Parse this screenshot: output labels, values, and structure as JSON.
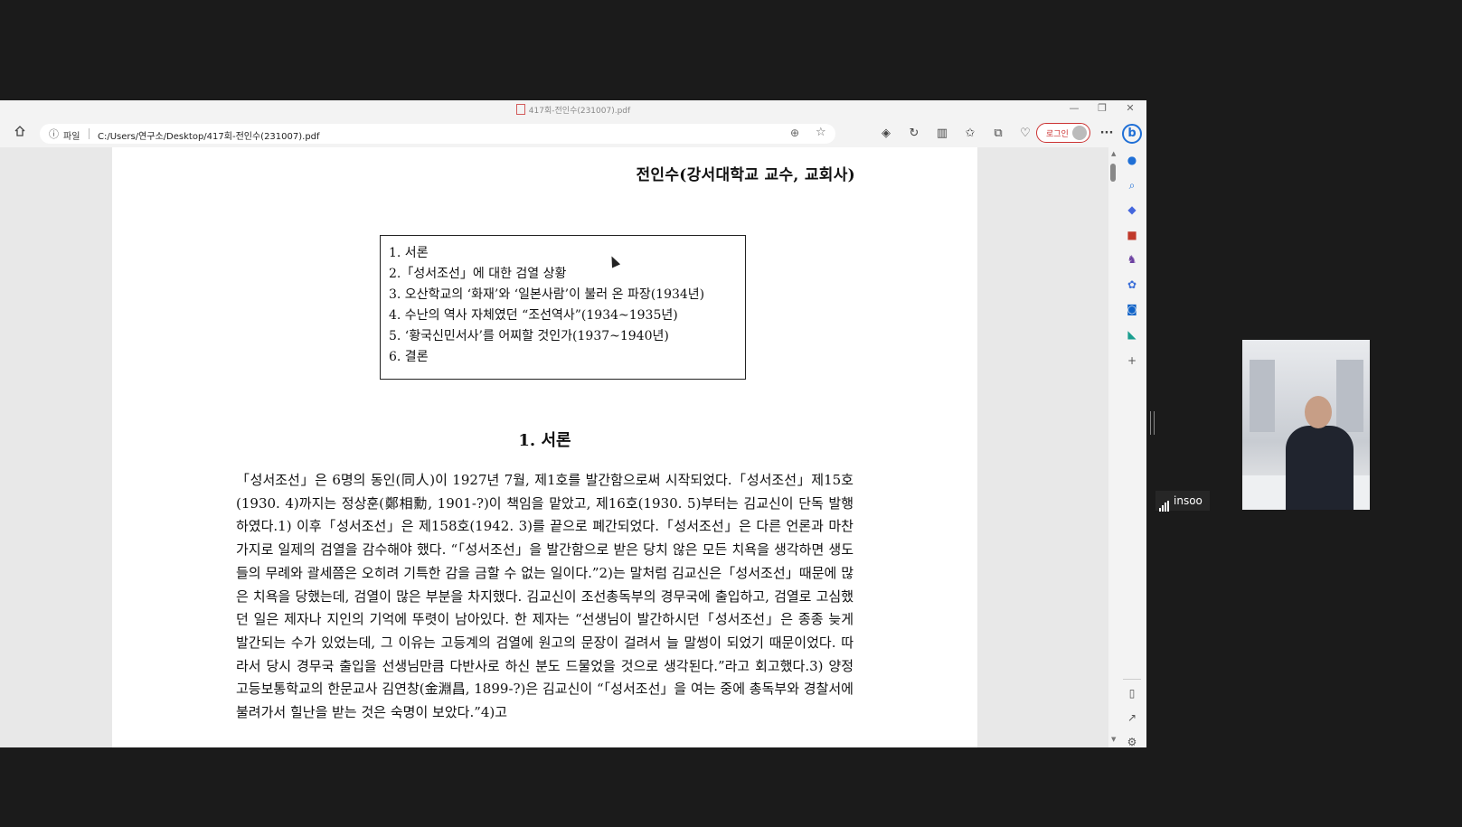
{
  "window": {
    "title": "417회-전인수(231007).pdf",
    "minimize": "—",
    "restore": "❐",
    "close": "✕"
  },
  "toolbar": {
    "home_icon": "home-icon",
    "info_icon": "info-icon",
    "address_label": "파일",
    "url": "C:/Users/연구소/Desktop/417회-전인수(231007).pdf",
    "login_label": "로그인",
    "more_label": "···",
    "bing_label": "b"
  },
  "document": {
    "author_line": "전인수(강서대학교 교수, 교회사)",
    "toc": [
      "1. 서론",
      "2.「성서조선」에 대한 검열 상황",
      "3. 오산학교의 ‘화재’와 ‘일본사람’이 불러 온 파장(1934년)",
      "4. 수난의 역사 자체였던 “조선역사”(1934~1935년)",
      "5. ‘황국신민서사’를 어찌할 것인가(1937~1940년)",
      "6. 결론"
    ],
    "section_heading": "1. 서론",
    "body": "「성서조선」은 6명의 동인(同人)이 1927년 7월, 제1호를 발간함으로써 시작되었다.「성서조선」제15호(1930. 4)까지는 정상훈(鄭相勳, 1901-?)이 책임을 맡았고, 제16호(1930. 5)부터는 김교신이 단독 발행하였다.1) 이후「성서조선」은 제158호(1942. 3)를 끝으로 폐간되었다.「성서조선」은 다른 언론과 마찬가지로 일제의 검열을 감수해야 했다. “「성서조선」을 발간함으로 받은 당치 않은 모든 치욕을 생각하면 생도들의 무례와 괄세쯤은 오히려 기특한 감을 금할 수 없는 일이다.”2)는 말처럼 김교신은「성서조선」때문에 많은 치욕을 당했는데, 검열이 많은 부분을 차지했다. 김교신이 조선총독부의 경무국에 출입하고, 검열로 고심했던 일은 제자나 지인의 기억에 뚜렷이 남아있다. 한 제자는 “선생님이 발간하시던「성서조선」은 종종 늦게 발간되는 수가 있었는데, 그 이유는 고등계의 검열에 원고의 문장이 걸려서 늘 말썽이 되었기 때문이었다. 따라서 당시 경무국 출입을 선생님만큼 다반사로 하신 분도 드물었을 것으로 생각된다.”라고 회고했다.3) 양정고등보통학교의 한문교사 김연창(金淵昌, 1899-?)은 김교신이 “「성서조선」을 여는 중에 총독부와 경찰서에 불려가서 힐난을 받는 것은 숙명이 보았다.”4)고"
  },
  "sidebar": {
    "icons": [
      "bell-icon",
      "search-icon",
      "tag-icon",
      "toolbox-icon",
      "chess-icon",
      "copilot-icon",
      "outlook-icon",
      "cart-icon",
      "add-icon",
      "panel-icon",
      "external-link-icon",
      "settings-icon"
    ]
  },
  "video": {
    "participant_name": "insoo"
  }
}
